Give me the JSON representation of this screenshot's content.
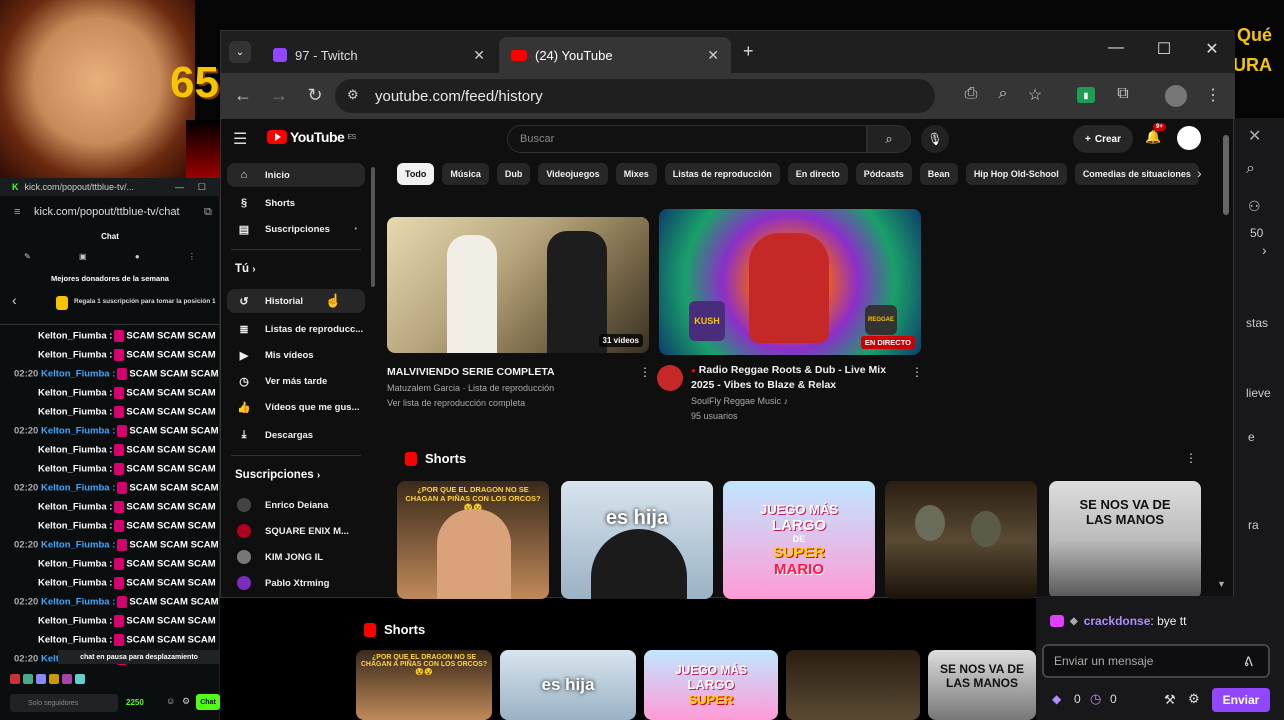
{
  "overlay": {
    "counter": "65",
    "right_text_1": "Qué",
    "right_text_2": "URA"
  },
  "browser": {
    "tabs": [
      {
        "label": "97 - Twitch",
        "icon": "twitch-icon"
      },
      {
        "label": "(24) YouTube",
        "icon": "youtube-icon"
      }
    ],
    "url": "youtube.com/feed/history"
  },
  "youtube": {
    "logo": "YouTube",
    "logo_sup": "ES",
    "search_placeholder": "Buscar",
    "create_label": "Crear",
    "notif_count": "9+",
    "sidebar": {
      "main": [
        {
          "label": "Inicio",
          "icon": "home-icon"
        },
        {
          "label": "Shorts",
          "icon": "shorts-icon"
        },
        {
          "label": "Suscripciones",
          "icon": "subscriptions-icon"
        }
      ],
      "you_header": "Tú",
      "you": [
        {
          "label": "Historial",
          "icon": "history-icon"
        },
        {
          "label": "Listas de reproducc...",
          "icon": "playlist-icon"
        },
        {
          "label": "Mis vídeos",
          "icon": "video-icon"
        },
        {
          "label": "Ver más tarde",
          "icon": "clock-icon"
        },
        {
          "label": "Vídeos que me gus...",
          "icon": "thumbs-up-icon"
        },
        {
          "label": "Descargas",
          "icon": "download-icon"
        }
      ],
      "subs_header": "Suscripciones",
      "subs": [
        {
          "label": "Enrico Deiana",
          "color": "#444444"
        },
        {
          "label": "SQUARE ENIX M...",
          "color": "#b00020"
        },
        {
          "label": "KIM JONG IL",
          "color": "#777777"
        },
        {
          "label": "Pablo Xtrming",
          "color": "#7b2cbf"
        }
      ]
    },
    "chips": [
      "Todo",
      "Música",
      "Dub",
      "Videojuegos",
      "Mixes",
      "Listas de reproducción",
      "En directo",
      "Pódcasts",
      "Bean",
      "Hip Hop Old-School",
      "Comedias de situaciones"
    ],
    "videos": [
      {
        "title": "MALVIVIENDO SERIE COMPLETA",
        "meta1": "Matuzalem Garcia · Lista de reproducción",
        "meta2": "Ver lista de reproducción completa",
        "badge": "31 vídeos"
      },
      {
        "title_1": "Radio Reggae Roots & Dub - Live Mix",
        "title_2": "2025 - Vibes to Blaze & Relax",
        "meta1": "SoulFly Reggae Music",
        "meta2": "95 usuarios",
        "badge": "EN DIRECTO",
        "thumb_text_1": "KUSH",
        "thumb_text_2": "REGGAE"
      }
    ],
    "shorts_header": "Shorts",
    "shorts": [
      {
        "text": "¿POR QUE EL DRAGON NO SE CHAGAN A PIÑAS CON LOS ORCOS? 😵😵"
      },
      {
        "text": "es hija"
      },
      {
        "text_1": "JUEGO MÁS",
        "text_2": "LARGO",
        "text_3": "DE",
        "text_4": "SUPER",
        "text_5": "MARIO"
      },
      {
        "text": ""
      },
      {
        "text_1": "SE NOS VA DE",
        "text_2": "LAS MANOS"
      }
    ]
  },
  "kick": {
    "window_title": "kick.com/popout/ttblue-tv/...",
    "url": "kick.com/popout/ttblue-tv/chat",
    "chat_label": "Chat",
    "donors_title": "Mejores donadores de la semana",
    "donors_sub": "Regala 1 suscripción para tomar la posición 1",
    "pause_notice": "chat en pausa para desplazamiento",
    "followers_placeholder": "Solo seguidores",
    "points": "2250",
    "chat_button": "Chat",
    "messages": [
      {
        "time": "",
        "name": "Kelton_Fiumba :",
        "text": "SCAM SCAM SCAM"
      },
      {
        "time": "",
        "name": "Kelton_Fiumba :",
        "text": "SCAM SCAM SCAM"
      },
      {
        "time": "02:20",
        "name": "Kelton_Fiumba :",
        "text": "SCAM SCAM SCAM"
      },
      {
        "time": "",
        "name": "Kelton_Fiumba :",
        "text": "SCAM SCAM SCAM"
      },
      {
        "time": "",
        "name": "Kelton_Fiumba :",
        "text": "SCAM SCAM SCAM"
      },
      {
        "time": "02:20",
        "name": "Kelton_Fiumba :",
        "text": "SCAM SCAM SCAM"
      },
      {
        "time": "",
        "name": "Kelton_Fiumba :",
        "text": "SCAM SCAM SCAM"
      },
      {
        "time": "",
        "name": "Kelton_Fiumba :",
        "text": "SCAM SCAM SCAM"
      },
      {
        "time": "02:20",
        "name": "Kelton_Fiumba :",
        "text": "SCAM SCAM SCAM"
      },
      {
        "time": "",
        "name": "Kelton_Fiumba :",
        "text": "SCAM SCAM SCAM"
      },
      {
        "time": "",
        "name": "Kelton_Fiumba :",
        "text": "SCAM SCAM SCAM"
      },
      {
        "time": "02:20",
        "name": "Kelton_Fiumba :",
        "text": "SCAM SCAM SCAM"
      },
      {
        "time": "",
        "name": "Kelton_Fiumba :",
        "text": "SCAM SCAM SCAM"
      },
      {
        "time": "",
        "name": "Kelton_Fiumba :",
        "text": "SCAM SCAM SCAM"
      },
      {
        "time": "02:20",
        "name": "Kelton_Fiumba :",
        "text": "SCAM SCAM SCAM"
      },
      {
        "time": "",
        "name": "Kelton_Fiumba :",
        "text": "SCAM SCAM SCAM"
      },
      {
        "time": "",
        "name": "Kelton_Fiumba :",
        "text": "SCAM SCAM SCAM"
      },
      {
        "time": "02:20",
        "name": "Kelton_Fiumba :",
        "text": "SCAM SCAM SCAM"
      }
    ]
  },
  "twitch": {
    "last_user": "crackdonse",
    "last_msg": ": bye tt",
    "input_placeholder": "Enviar un mensaje",
    "send_label": "Enviar",
    "bits": "0",
    "points": "0",
    "right_strip": [
      "50",
      "stas",
      "lieve",
      "e",
      "ra"
    ]
  }
}
